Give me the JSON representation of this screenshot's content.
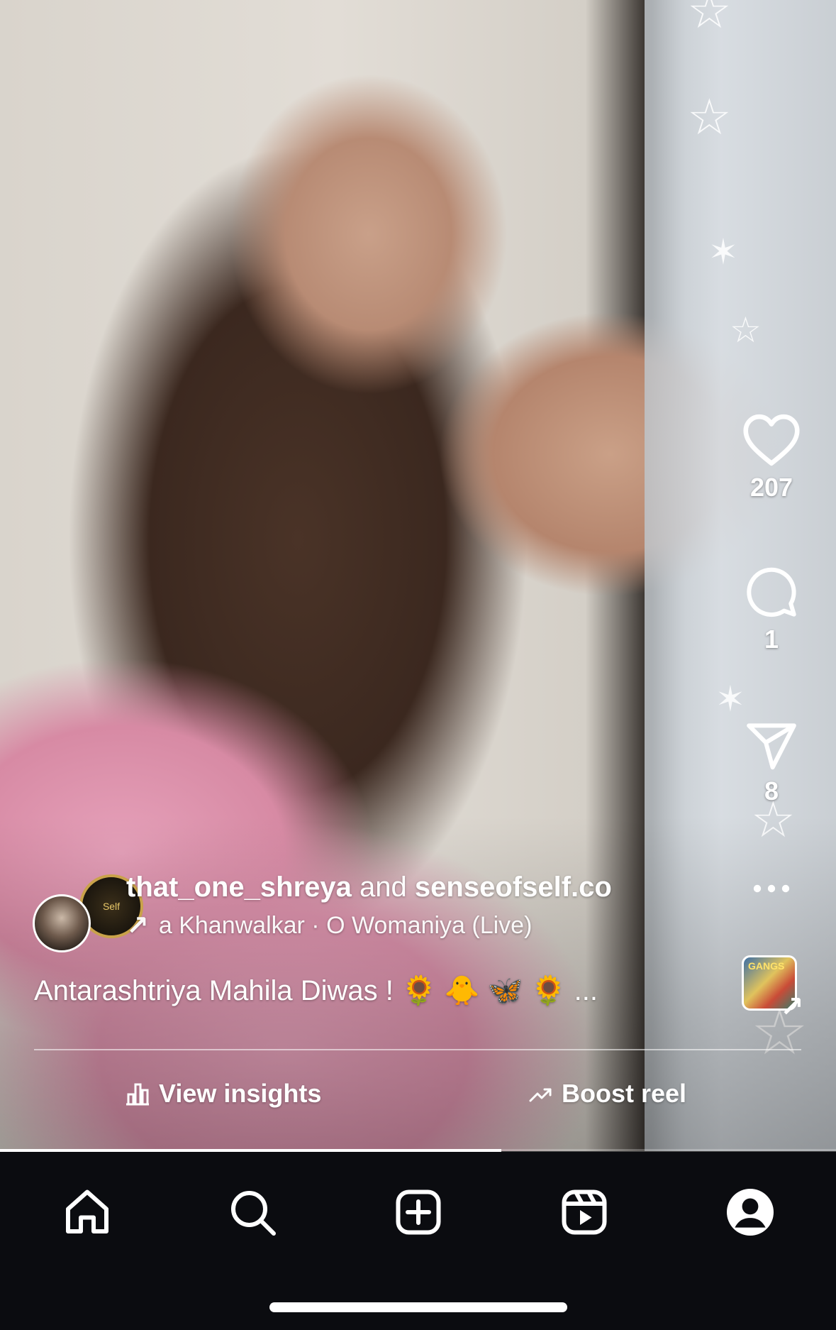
{
  "reel": {
    "likes": "207",
    "comments": "1",
    "shares": "8",
    "progress_fraction": 0.6
  },
  "author": {
    "primary_username": "that_one_shreya",
    "connector": "and",
    "collab_username": "senseofself.co",
    "collab_avatar_text": "Self"
  },
  "audio": {
    "text": "a Khanwalkar · O Womaniya (Live)",
    "icon": "arrow-icon"
  },
  "caption": {
    "text": "Antarashtriya Mahila Diwas ! 🌻 🐥 🦋 🌻  ..."
  },
  "audio_thumbnail": {
    "label": "GANGS"
  },
  "actions": {
    "insights_label": "View insights",
    "boost_label": "Boost reel"
  },
  "nav": {
    "items": [
      "home-icon",
      "search-icon",
      "create-icon",
      "reels-icon",
      "profile-icon"
    ]
  }
}
